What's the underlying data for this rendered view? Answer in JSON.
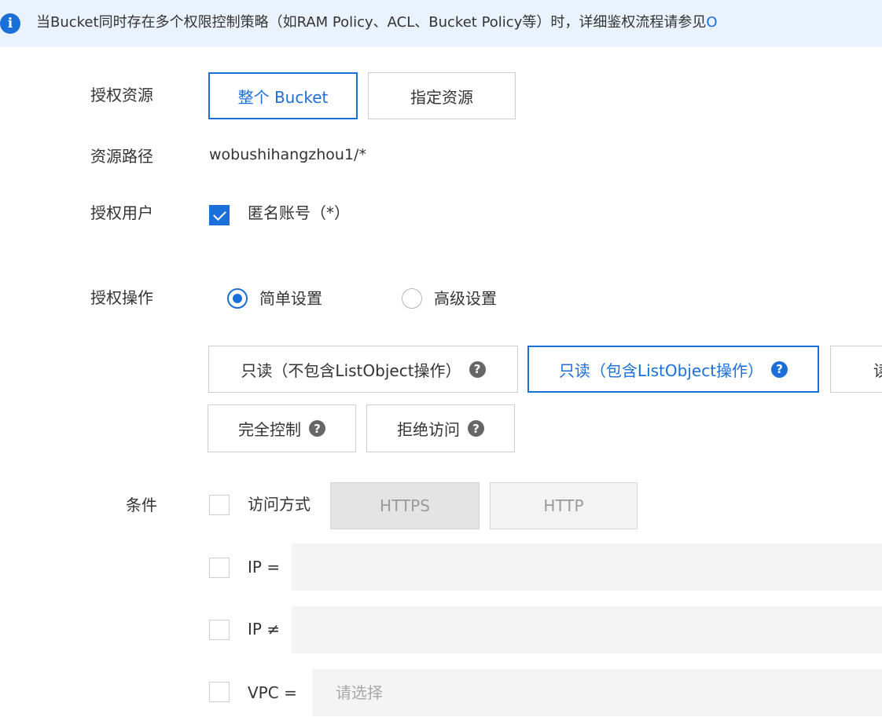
{
  "notice": {
    "icon": "info-icon",
    "text": "当Bucket同时存在多个权限控制策略（如RAM Policy、ACL、Bucket Policy等）时，详细鉴权流程请参见",
    "link_text": "O"
  },
  "labels": {
    "resource": "授权资源",
    "path": "资源路径",
    "user": "授权用户",
    "operation": "授权操作",
    "condition": "条件"
  },
  "resource": {
    "options": [
      "整个 Bucket",
      "指定资源"
    ],
    "selected": "整个 Bucket"
  },
  "path_value": "wobushihangzhou1/*",
  "user": {
    "anonymous_label": "匿名账号（*）",
    "anonymous_checked": true
  },
  "operation": {
    "modes": [
      "简单设置",
      "高级设置"
    ],
    "selected_mode": "简单设置",
    "permissions": [
      {
        "label": "只读（不包含ListObject操作）"
      },
      {
        "label": "只读（包含ListObject操作）"
      },
      {
        "label": "读"
      },
      {
        "label": "完全控制"
      },
      {
        "label": "拒绝访问"
      }
    ],
    "selected_permission": "只读（包含ListObject操作）",
    "help_glyph": "?"
  },
  "conditions": {
    "access_method_label": "访问方式",
    "protocols": [
      "HTTPS",
      "HTTP"
    ],
    "ip_eq_label": "IP =",
    "ip_ne_label": "IP ≠",
    "vpc_label": "VPC =",
    "vpc_placeholder": "请选择",
    "ip_eq_value": "",
    "ip_ne_value": ""
  },
  "colors": {
    "accent": "#1a6fd9",
    "notice_bg": "#eaf3fd",
    "disabled_bg": "#e4e4e4"
  }
}
